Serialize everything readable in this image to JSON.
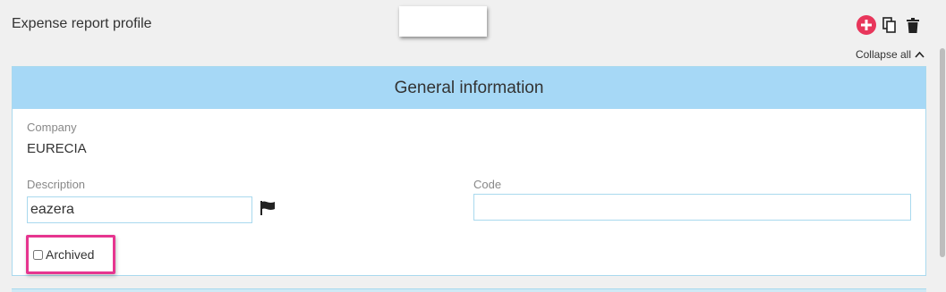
{
  "header": {
    "title": "Expense report profile",
    "actions": {
      "add_icon": "plus-circle-icon",
      "duplicate_icon": "copy-icon",
      "delete_icon": "trash-icon"
    },
    "collapse_all_label": "Collapse all"
  },
  "general_section": {
    "title": "General information",
    "company_label": "Company",
    "company_value": "EURECIA",
    "description_label": "Description",
    "description_value": "eazera",
    "code_label": "Code",
    "code_value": "",
    "archived_label": "Archived",
    "archived_checked": false
  },
  "colors": {
    "accent": "#e8365b",
    "header_bg": "#a6d8f6",
    "highlight": "#e6358f"
  }
}
